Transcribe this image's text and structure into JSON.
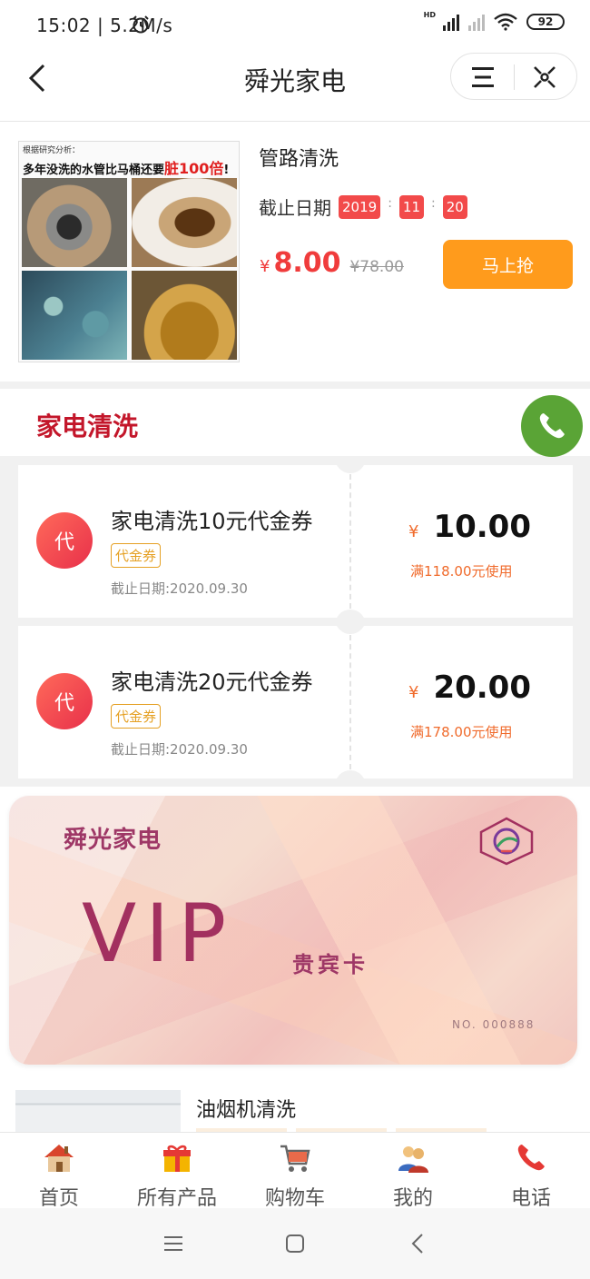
{
  "status_bar": {
    "time": "15:02 | 5.2M/s",
    "network_badge": "HD",
    "battery": "92",
    "icons": [
      "alarm-icon",
      "signal-icon",
      "wifi-icon",
      "battery-icon"
    ]
  },
  "nav": {
    "title": "舜光家电",
    "back_icon": "chevron-left-icon",
    "menu_icon": "menu-icon",
    "close_icon": "close-icon"
  },
  "product": {
    "image_caption_small": "根据研究分析：",
    "image_caption_main": "多年没洗的水管比马桶还要",
    "image_caption_highlight": "脏100倍",
    "image_caption_end": "!",
    "name": "管路清洗",
    "deadline_label": "截止日期",
    "deadline": [
      "2019",
      "11",
      "20"
    ],
    "deadline_sep": ":",
    "currency": "¥",
    "price": "8.00",
    "original_price": "¥78.00",
    "buy_label": "马上抢"
  },
  "section": {
    "title": "家电清洗",
    "fab_icon": "phone-icon"
  },
  "coupons": [
    {
      "badge": "代",
      "name": "家电清洗10元代金券",
      "tag": "代金券",
      "deadline": "截止日期:2020.09.30",
      "currency": "¥",
      "amount": "10.00",
      "condition": "满118.00元使用"
    },
    {
      "badge": "代",
      "name": "家电清洗20元代金券",
      "tag": "代金券",
      "deadline": "截止日期:2020.09.30",
      "currency": "¥",
      "amount": "20.00",
      "condition": "满178.00元使用"
    }
  ],
  "vip_card": {
    "brand": "舜光家电",
    "title": "VIP",
    "subtitle": "贵宾卡",
    "number": "NO. 000888"
  },
  "next_product": {
    "name": "油烟机清洗"
  },
  "tabbar": [
    {
      "label": "首页",
      "icon": "home-icon"
    },
    {
      "label": "所有产品",
      "icon": "gift-icon"
    },
    {
      "label": "购物车",
      "icon": "cart-icon"
    },
    {
      "label": "我的",
      "icon": "user-icon"
    },
    {
      "label": "电话",
      "icon": "phone-icon"
    }
  ],
  "system_nav": [
    "menu-key-icon",
    "home-key-icon",
    "back-key-icon"
  ],
  "colors": {
    "accent_red": "#c3162a",
    "price_red": "#f03c3c",
    "buy_orange": "#ff9b1c",
    "fab_green": "#5aa436",
    "coupon_orange": "#f06b2c"
  }
}
